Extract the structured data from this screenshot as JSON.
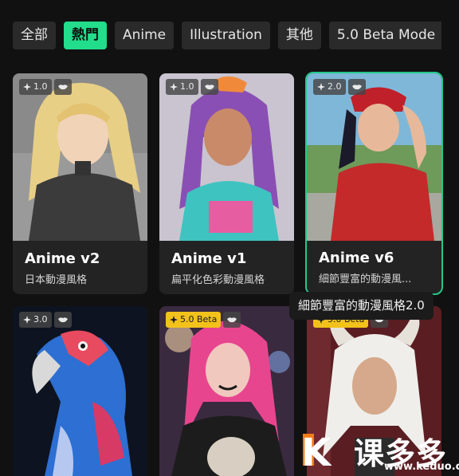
{
  "tabs": [
    {
      "label": "全部",
      "active": false
    },
    {
      "label": "熱門",
      "active": true
    },
    {
      "label": "Anime",
      "active": false
    },
    {
      "label": "Illustration",
      "active": false
    },
    {
      "label": "其他",
      "active": false
    },
    {
      "label": "5.0 Beta Mode",
      "active": false
    }
  ],
  "cards": [
    {
      "version": "1.0",
      "name": "Anime v2",
      "desc": "日本動漫風格"
    },
    {
      "version": "1.0",
      "name": "Anime v1",
      "desc": "扁平化色彩動漫風格"
    },
    {
      "version": "2.0",
      "name": "Anime v6",
      "desc": "細節豐富的動漫風..."
    },
    {
      "version": "3.0"
    },
    {
      "version": "5.0 Beta"
    },
    {
      "version": "5.0 Beta"
    }
  ],
  "tooltip": "細節豐富的動漫風格2.0",
  "watermark": {
    "word": "课多多",
    "site": "www.keduo.cn"
  },
  "colors": {
    "accent": "#21dd8c",
    "beta": "#f2c21b",
    "selected_border": "#22c98a"
  }
}
